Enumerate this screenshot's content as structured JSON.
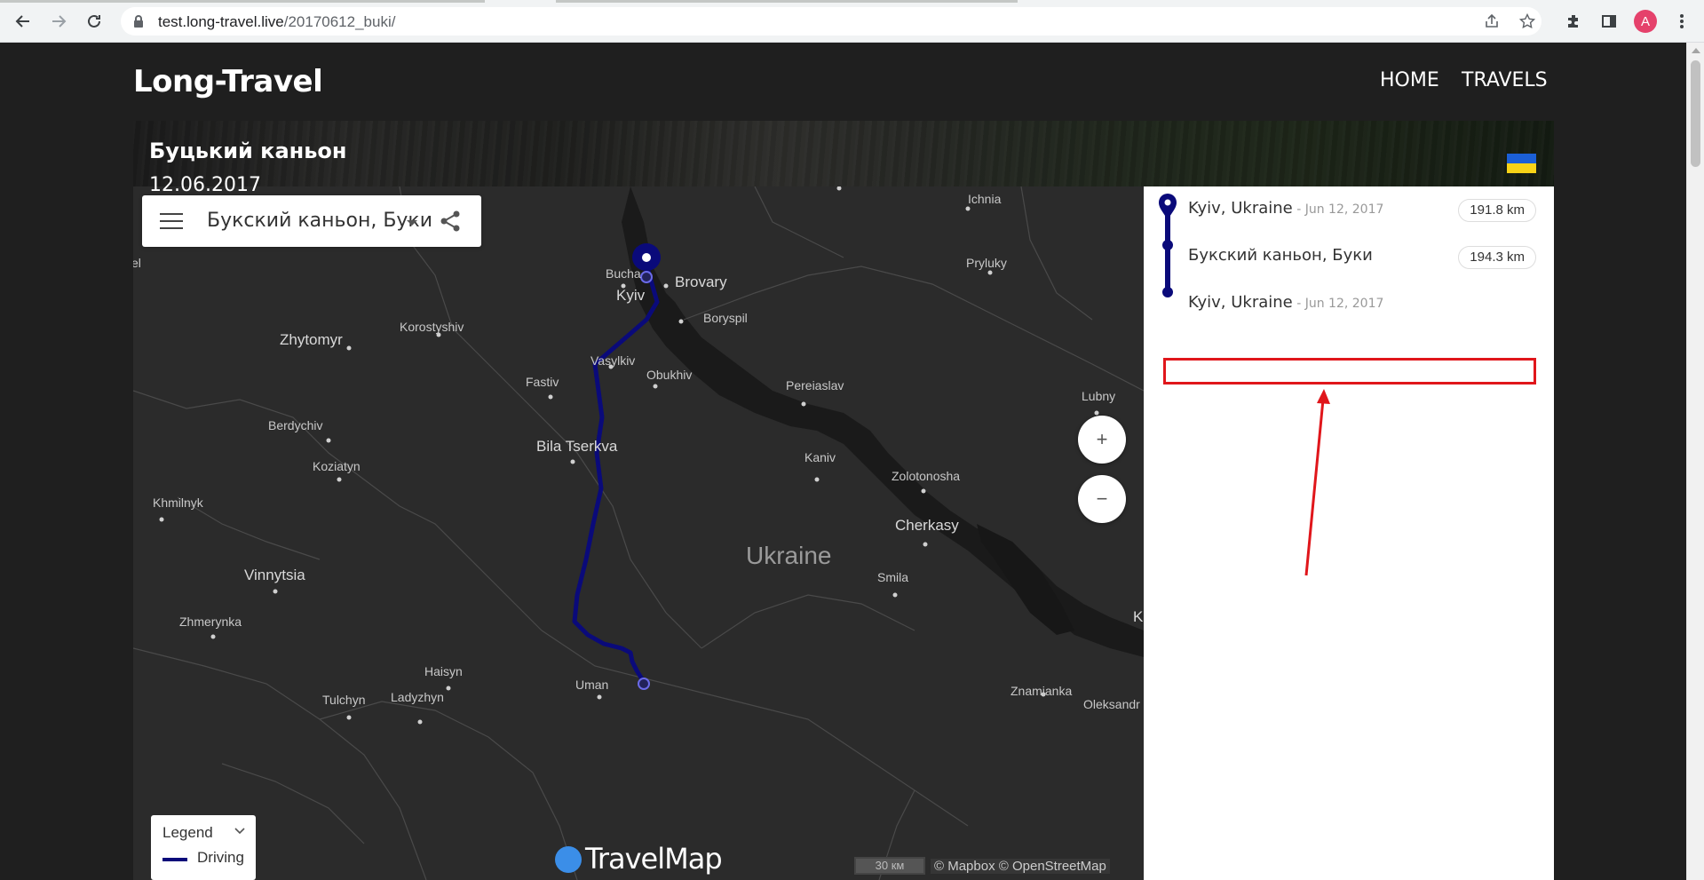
{
  "browser": {
    "url_host": "test.long-travel.live",
    "url_path": "/20170612_buki/",
    "profile_initial": "A"
  },
  "site": {
    "title": "Long-Travel",
    "nav": [
      "HOME",
      "TRAVELS"
    ]
  },
  "hero": {
    "title": "Буцький каньон",
    "date": "12.06.2017",
    "flag_colors": [
      "#1b5fd6",
      "#f7d217"
    ]
  },
  "map": {
    "search_title": "Букский каньон, Буки",
    "zoom_in": "+",
    "zoom_out": "−",
    "legend_title": "Legend",
    "legend_item": "Driving",
    "brand": "TravelMap",
    "scale": "30 км",
    "attribution": "© Mapbox © OpenStreetMap",
    "route_color": "#0a0a7a",
    "labels": {
      "ichnia": "Ichnia",
      "pryluky": "Pryluky",
      "bucha": "Bucha",
      "brovary": "Brovary",
      "kyiv": "Kyiv",
      "boryspil": "Boryspil",
      "korostyshiv": "Korostyshiv",
      "zhytomyr": "Zhytomyr",
      "vasylkiv": "Vasylkiv",
      "fastiv": "Fastiv",
      "obukhiv": "Obukhiv",
      "pereiaslav": "Pereiaslav",
      "lubny": "Lubny",
      "berdychiv": "Berdychiv",
      "bila_tserkva": "Bila Tserkva",
      "kaniv": "Kaniv",
      "koziatyn": "Koziatyn",
      "zolotonosha": "Zolotonosha",
      "khmilnyk": "Khmilnyk",
      "cherkasy": "Cherkasy",
      "ukraine": "Ukraine",
      "vinnytsia": "Vinnytsia",
      "smila": "Smila",
      "zhmerynka": "Zhmerynka",
      "haisyn": "Haisyn",
      "uman": "Uman",
      "znamianka": "Znamianka",
      "tulchyn": "Tulchyn",
      "ladyzhyn": "Ladyzhyn",
      "oleksandr": "Oleksandr",
      "edge_left": "el",
      "edge_right": "K"
    }
  },
  "itinerary": {
    "stops": [
      {
        "name": "Kyiv, Ukraine",
        "date": " - Jun 12, 2017",
        "distance": "191.8 km"
      },
      {
        "name": "Букский каньон, Буки",
        "date": "",
        "distance": "194.3 km"
      },
      {
        "name": "Kyiv, Ukraine",
        "date": " - Jun 12, 2017",
        "distance": ""
      }
    ]
  }
}
